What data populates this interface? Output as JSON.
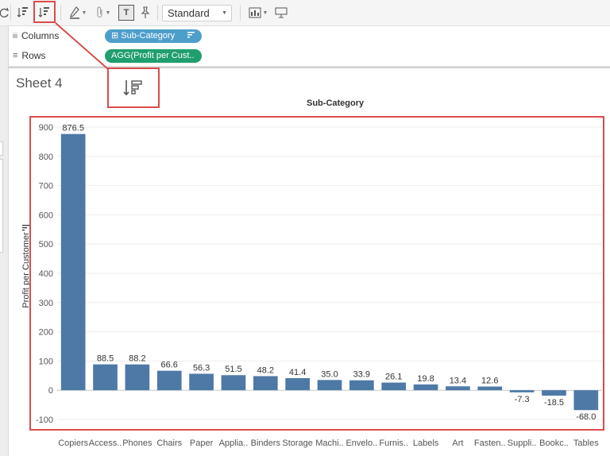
{
  "toolbar": {
    "mark_size_value": "Standard",
    "format_label": "T"
  },
  "shelves": {
    "columns_label": "Columns",
    "columns_pill": "⊞ Sub-Category",
    "rows_label": "Rows",
    "rows_pill": "AGG(Profit per Cust.."
  },
  "sheet": {
    "title": "Sheet 4",
    "column_header": "Sub-Category"
  },
  "colors": {
    "bar": "#4e79a7",
    "highlight": "#dc4b4b",
    "pill_columns": "#4e9ecb",
    "pill_rows": "#1f9e6e"
  },
  "chart_data": {
    "type": "bar",
    "xlabel": "Sub-Category",
    "ylabel": "Profit per Customer",
    "ylim": [
      -100,
      900
    ],
    "yticks": [
      -100,
      0,
      100,
      200,
      300,
      400,
      500,
      600,
      700,
      800,
      900
    ],
    "grid": true,
    "categories": [
      "Copiers",
      "Access..",
      "Phones",
      "Chairs",
      "Paper",
      "Applia..",
      "Binders",
      "Storage",
      "Machi..",
      "Envelo..",
      "Furnis..",
      "Labels",
      "Art",
      "Fasten..",
      "Suppli..",
      "Bookc..",
      "Tables"
    ],
    "values": [
      876.5,
      88.5,
      88.2,
      66.6,
      56.3,
      51.5,
      48.2,
      41.4,
      35.0,
      33.9,
      26.1,
      19.8,
      13.4,
      12.6,
      -7.3,
      -18.5,
      -68.0
    ],
    "value_labels": [
      "876.5",
      "88.5",
      "88.2",
      "66.6",
      "56.3",
      "51.5",
      "48.2",
      "41.4",
      "35.0",
      "33.9",
      "26.1",
      "19.8",
      "13.4",
      "12.6",
      "-7.3",
      "-18.5",
      "-68.0"
    ]
  }
}
